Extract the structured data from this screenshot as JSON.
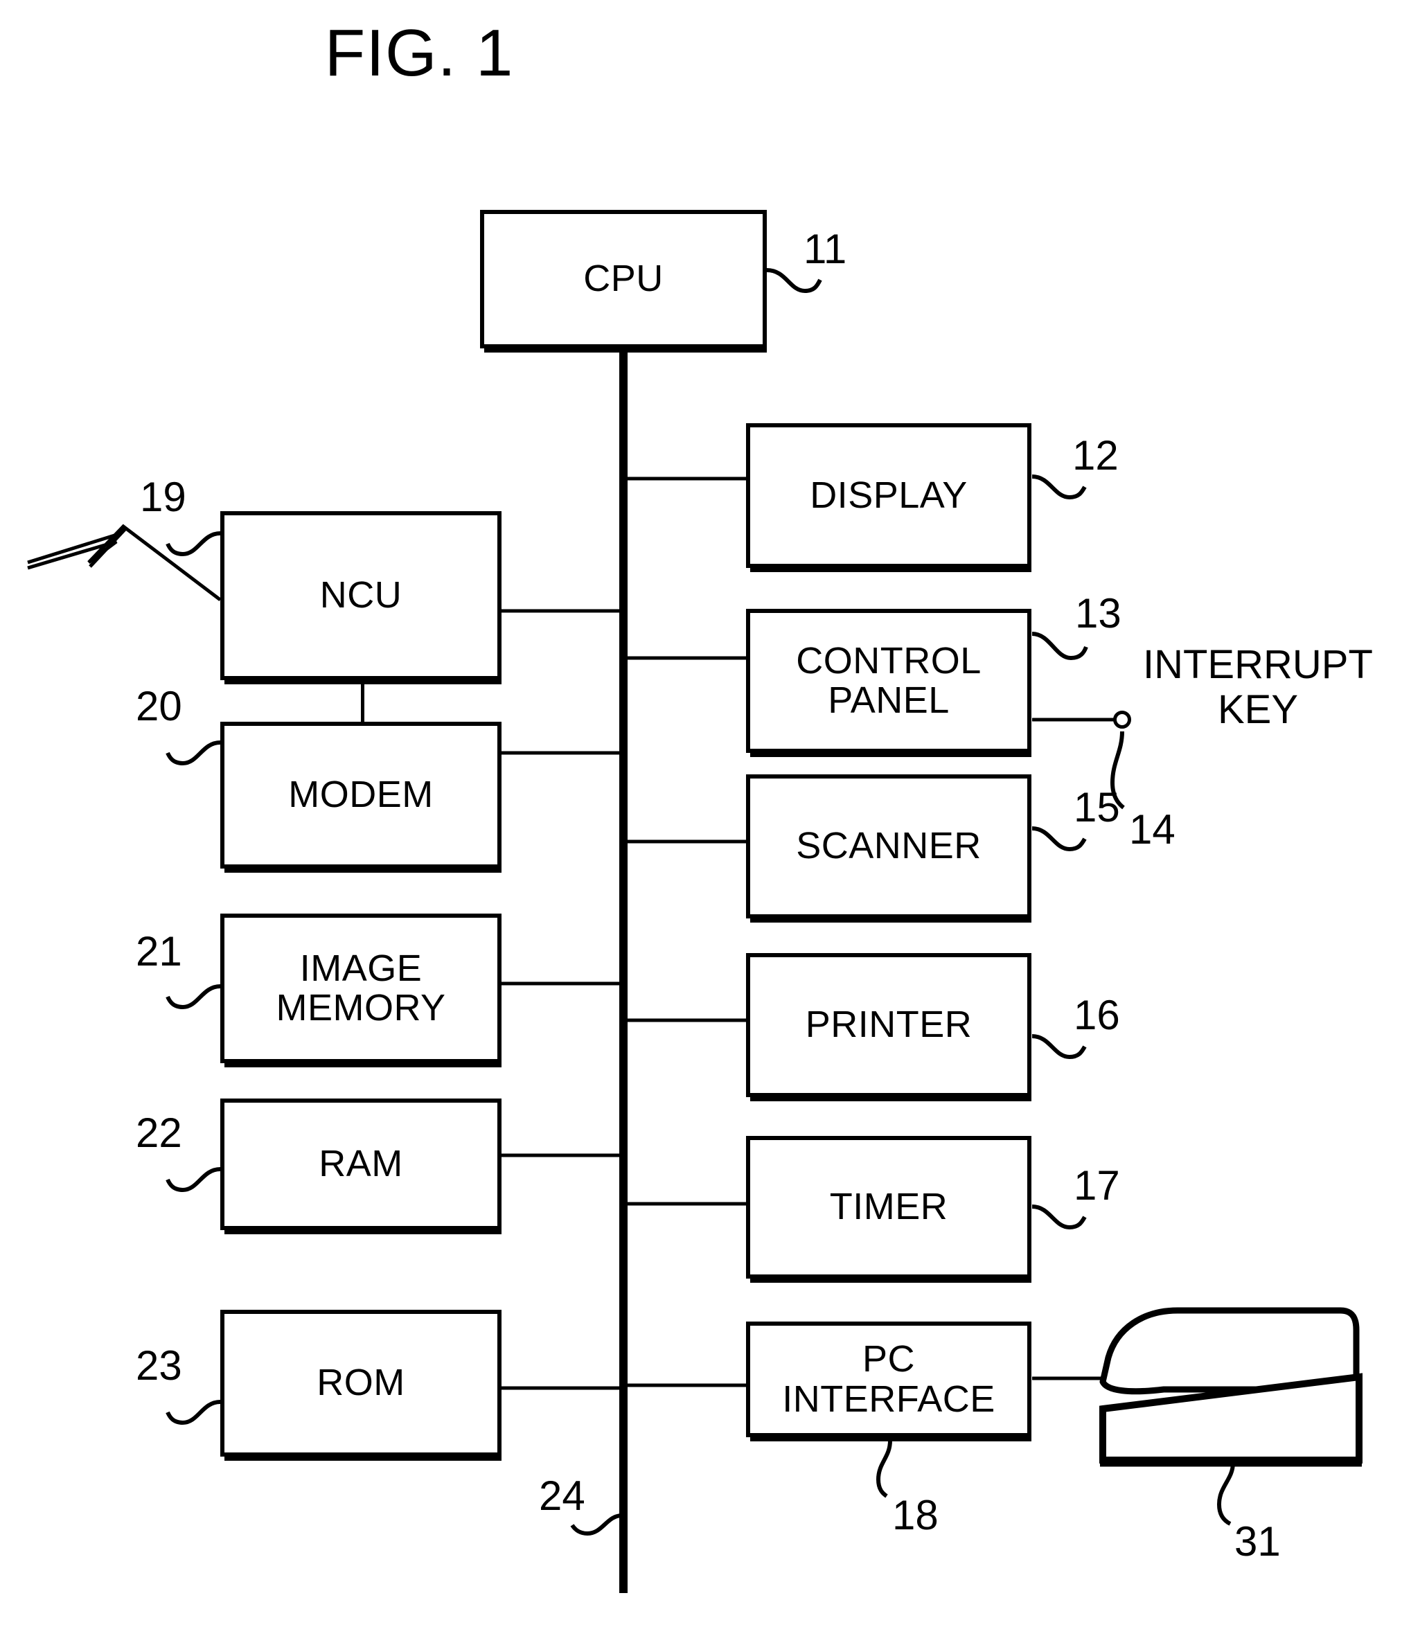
{
  "figure": {
    "title": "FIG. 1",
    "type": "patent-block-diagram",
    "subject": "facsimile apparatus control block diagram"
  },
  "blocks": [
    {
      "id": "cpu",
      "label": "CPU",
      "ref": "11",
      "side": "top"
    },
    {
      "id": "display",
      "label": "DISPLAY",
      "ref": "12",
      "side": "right"
    },
    {
      "id": "control-panel",
      "label": "CONTROL\nPANEL",
      "ref": "13",
      "side": "right"
    },
    {
      "id": "scanner",
      "label": "SCANNER",
      "ref": "15",
      "side": "right"
    },
    {
      "id": "printer",
      "label": "PRINTER",
      "ref": "16",
      "side": "right"
    },
    {
      "id": "timer",
      "label": "TIMER",
      "ref": "17",
      "side": "right"
    },
    {
      "id": "pc-interface",
      "label": "PC\nINTERFACE",
      "ref": "18",
      "side": "right"
    },
    {
      "id": "ncu",
      "label": "NCU",
      "ref": "19",
      "side": "left"
    },
    {
      "id": "modem",
      "label": "MODEM",
      "ref": "20",
      "side": "left"
    },
    {
      "id": "image-memory",
      "label": "IMAGE\nMEMORY",
      "ref": "21",
      "side": "left"
    },
    {
      "id": "ram",
      "label": "RAM",
      "ref": "22",
      "side": "left"
    },
    {
      "id": "rom",
      "label": "ROM",
      "ref": "23",
      "side": "left"
    }
  ],
  "block_labels": {
    "cpu": "CPU",
    "display": "DISPLAY",
    "control_panel_line1": "CONTROL",
    "control_panel_line2": "PANEL",
    "scanner": "SCANNER",
    "printer": "PRINTER",
    "timer": "TIMER",
    "pc_interface_line1": "PC",
    "pc_interface_line2": "INTERFACE",
    "ncu": "NCU",
    "modem": "MODEM",
    "image_memory_line1": "IMAGE",
    "image_memory_line2": "MEMORY",
    "ram": "RAM",
    "rom": "ROM"
  },
  "ref_numbers": {
    "cpu": "11",
    "display": "12",
    "control_panel": "13",
    "interrupt_key": "14",
    "scanner": "15",
    "printer": "16",
    "timer": "17",
    "pc_interface": "18",
    "ncu": "19",
    "modem": "20",
    "image_memory": "21",
    "ram": "22",
    "rom": "23",
    "bus": "24",
    "personal_computer": "31"
  },
  "external_labels": {
    "interrupt_key_line1": "INTERRUPT",
    "interrupt_key_line2": "KEY"
  },
  "elements": {
    "bus_name": "system bus",
    "telephone_line_name": "telephone line",
    "personal_computer_name": "personal computer"
  },
  "colors": {
    "ink": "#000000",
    "paper": "#ffffff"
  }
}
